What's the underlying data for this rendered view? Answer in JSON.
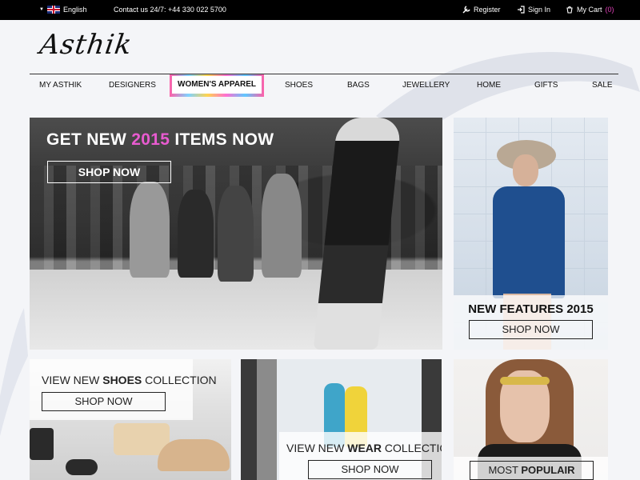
{
  "topbar": {
    "language": "English",
    "contact": "Contact us 24/7: +44 330 022 5700",
    "register": "Register",
    "sign_in": "Sign In",
    "cart_label": "My Cart",
    "cart_count": "(0)"
  },
  "brand": {
    "logo_text": "Asthik"
  },
  "nav": {
    "items": [
      "MY ASTHIK",
      "DESIGNERS",
      "WOMEN'S APPAREL",
      "SHOES",
      "BAGS",
      "JEWELLERY",
      "HOME",
      "GIFTS",
      "SALE"
    ],
    "active": "WOMEN'S APPAREL"
  },
  "hero": {
    "title_prefix": "GET NEW",
    "title_highlight": "2015",
    "title_suffix": "ITEMS NOW",
    "button": "SHOP NOW"
  },
  "features": {
    "title": "NEW FEATURES 2015",
    "button": "SHOP NOW"
  },
  "shoes_promo": {
    "prefix": "VIEW NEW",
    "bold": "SHOES",
    "suffix": "COLLECTION",
    "button": "SHOP NOW"
  },
  "wear_promo": {
    "prefix": "VIEW NEW",
    "bold": "WEAR",
    "suffix": "COLLECTION",
    "button": "SHOP NOW"
  },
  "popular": {
    "prefix": "MOST",
    "bold": "POPULAIR"
  },
  "colors": {
    "highlight": "#e85bd0",
    "cart_count": "#e040b8",
    "topbar": "#000000"
  }
}
